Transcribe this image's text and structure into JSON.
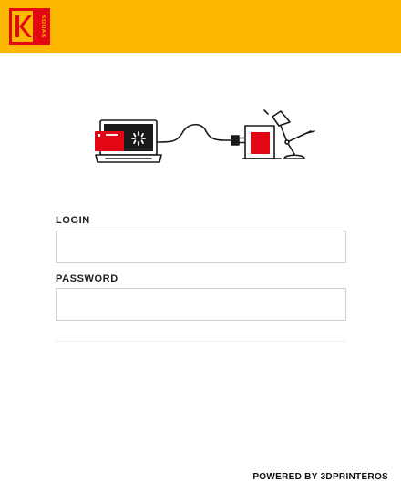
{
  "header": {
    "brand_color": "#FFB800",
    "logo_text": "KODAK",
    "logo_color": "#E30613",
    "logo_icon": "kodak-logo"
  },
  "hero": {
    "illustration": "laptop-to-printer-connection",
    "accent_color": "#E30613"
  },
  "form": {
    "login_label": "LOGIN",
    "login_value": "",
    "password_label": "PASSWORD",
    "password_value": ""
  },
  "footer": {
    "powered_by": "POWERED BY 3DPRINTEROS"
  }
}
